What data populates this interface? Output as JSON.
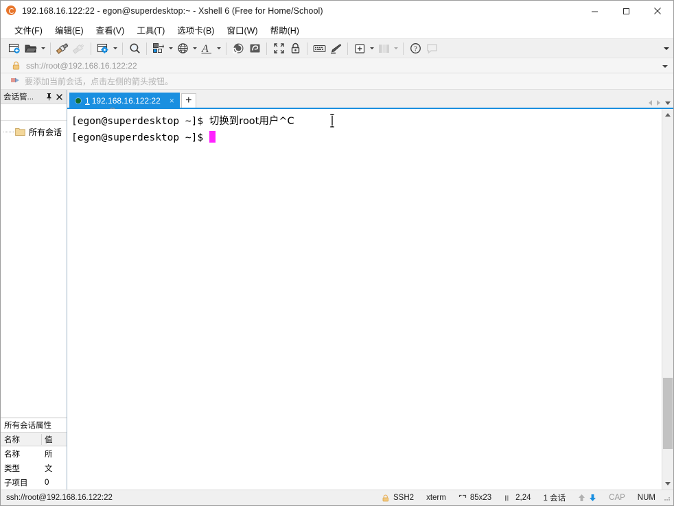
{
  "window": {
    "title": "192.168.16.122:22 - egon@superdesktop:~ - Xshell 6 (Free for Home/School)",
    "app_icon": "xshell-spiral-icon",
    "minimize_label": "Minimize",
    "maximize_label": "Maximize",
    "close_label": "Close"
  },
  "menubar": {
    "items": [
      {
        "label": "文件(F)",
        "name": "menu-file"
      },
      {
        "label": "编辑(E)",
        "name": "menu-edit"
      },
      {
        "label": "查看(V)",
        "name": "menu-view"
      },
      {
        "label": "工具(T)",
        "name": "menu-tools"
      },
      {
        "label": "选项卡(B)",
        "name": "menu-tabs"
      },
      {
        "label": "窗口(W)",
        "name": "menu-window"
      },
      {
        "label": "帮助(H)",
        "name": "menu-help"
      }
    ]
  },
  "toolbar": {
    "buttons": [
      {
        "name": "new-session-icon",
        "tooltip": "新建"
      },
      {
        "name": "open-folder-icon",
        "tooltip": "打开"
      },
      {
        "name": "connect-plug-icon",
        "tooltip": "连接"
      },
      {
        "name": "disconnect-plug-icon",
        "tooltip": "断开"
      },
      {
        "name": "session-properties-icon",
        "tooltip": "属性"
      },
      {
        "name": "find-magnifier-icon",
        "tooltip": "查找"
      },
      {
        "name": "file-transfer-icon",
        "tooltip": "传输"
      },
      {
        "name": "globe-icon",
        "tooltip": "编码"
      },
      {
        "name": "font-italic-A-icon",
        "tooltip": "字体"
      },
      {
        "name": "xshell-spiral-icon",
        "tooltip": "Xshell"
      },
      {
        "name": "xftp-icon",
        "tooltip": "Xftp"
      },
      {
        "name": "fullscreen-icon",
        "tooltip": "全屏"
      },
      {
        "name": "lock-icon",
        "tooltip": "锁定"
      },
      {
        "name": "keyboard-icon",
        "tooltip": "键盘"
      },
      {
        "name": "highlight-pen-icon",
        "tooltip": "高亮"
      },
      {
        "name": "add-tab-icon",
        "tooltip": "新建选项卡"
      },
      {
        "name": "layout-columns-icon",
        "tooltip": "布局"
      },
      {
        "name": "help-question-icon",
        "tooltip": "帮助"
      },
      {
        "name": "comment-bubble-icon",
        "tooltip": "留言"
      }
    ],
    "overflow_label": "更多"
  },
  "addressbar": {
    "value": "ssh://root@192.168.16.122:22",
    "placeholder": "ssh://root@192.168.16.122:22",
    "lock_icon": "lock-icon",
    "dropdown_label": "历史记录"
  },
  "notification": {
    "text": "要添加当前会话，点击左侧的箭头按钮。",
    "icon": "arrow-flag-icon"
  },
  "sidebar": {
    "title": "会话管...",
    "pin_label": "固定",
    "close_label": "关闭",
    "search": {
      "value": "",
      "placeholder": ""
    },
    "search_icon": "search-icon",
    "tree": [
      {
        "label": "所有会话",
        "icon": "folder-icon"
      }
    ],
    "properties": {
      "title": "所有会话属性",
      "columns": [
        "名称",
        "值"
      ],
      "rows": [
        {
          "name": "名称",
          "value": "所"
        },
        {
          "name": "类型",
          "value": "文"
        },
        {
          "name": "子项目",
          "value": "0"
        }
      ]
    }
  },
  "tabs": {
    "items": [
      {
        "number": "1",
        "label": "192.168.16.122:22",
        "status_dot": "connected",
        "close_label": "×"
      }
    ],
    "new_tab_label": "+",
    "scroll_left_label": "向左",
    "scroll_right_label": "向右",
    "tab_list_label": "选项卡列表"
  },
  "terminal": {
    "lines": [
      {
        "prompt": "[egon@superdesktop ~]$ ",
        "text": "切换到root用户^C",
        "cursor": false
      },
      {
        "prompt": "[egon@superdesktop ~]$ ",
        "text": "",
        "cursor": true
      }
    ],
    "cursor_color": "#ff22ff",
    "background": "#ffffff",
    "foreground": "#000000"
  },
  "scrollbar": {
    "up_label": "向上滚动",
    "down_label": "向下滚动",
    "thumb_label": "滚动条"
  },
  "statusbar": {
    "connection": "ssh://root@192.168.16.122:22",
    "protocol": "SSH2",
    "terminal_type": "xterm",
    "size": "85x23",
    "cursor_pos": "2,24",
    "sessions": "1 会话",
    "cap": "CAP",
    "num": "NUM",
    "upload_icon": "arrow-up-icon",
    "download_icon": "arrow-down-icon",
    "protocol_icon": "lock-icon",
    "size_icon": "terminal-size-icon",
    "pos_icon": "cursor-pos-icon"
  },
  "colors": {
    "tab_active": "#1a8fe0",
    "accent": "#1a8fe0",
    "cursor": "#ff22ff",
    "dot_connected": "#136b2d",
    "titlebar_bg": "#ffffff",
    "chrome_bg": "#f0f0f0"
  }
}
